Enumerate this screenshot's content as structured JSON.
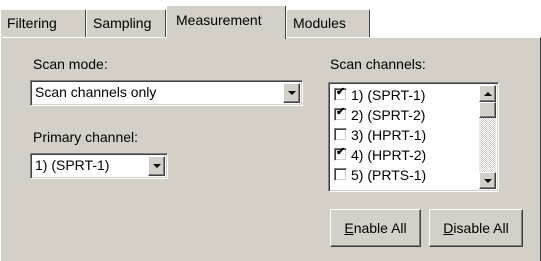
{
  "tabs": {
    "filtering": "Filtering",
    "sampling": "Sampling",
    "measurement": "Measurement",
    "modules": "Modules",
    "active": "Measurement"
  },
  "measurement": {
    "scan_mode": {
      "label": "Scan mode:",
      "value": "Scan channels only"
    },
    "primary_channel": {
      "label": "Primary channel:",
      "value": "1) (SPRT-1)"
    },
    "scan_channels": {
      "label": "Scan channels:",
      "items": [
        {
          "label": "1) (SPRT-1)",
          "checked": true
        },
        {
          "label": "2) (SPRT-2)",
          "checked": true
        },
        {
          "label": "3) (HPRT-1)",
          "checked": false
        },
        {
          "label": "4) (HPRT-2)",
          "checked": true
        },
        {
          "label": "5) (PRTS-1)",
          "checked": false
        }
      ]
    },
    "enable_all": {
      "accel": "E",
      "rest": "nable All"
    },
    "disable_all": {
      "accel": "D",
      "rest": "isable All"
    }
  },
  "colors": {
    "face": "#d4d0c8",
    "highlight": "#ffffff",
    "shadow": "#808080",
    "dark_shadow": "#404040"
  },
  "icons": {
    "dropdown": "chevron-down-icon",
    "scroll_up": "scroll-up-icon",
    "scroll_down": "scroll-down-icon",
    "check": "check-icon"
  }
}
